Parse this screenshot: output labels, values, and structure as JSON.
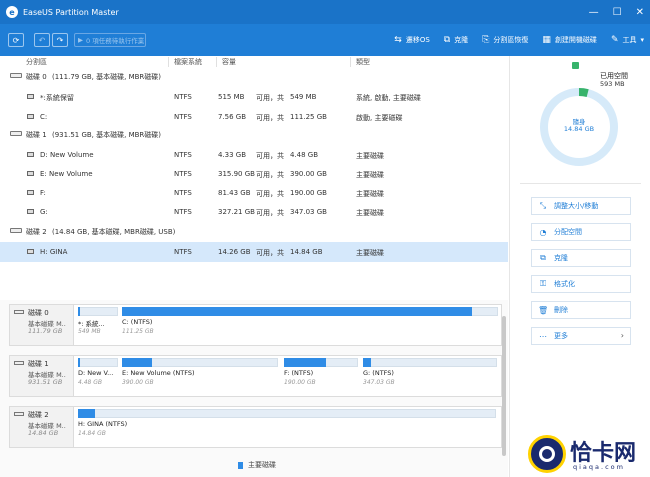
{
  "window": {
    "title": "EaseUS Partition Master",
    "minimize": "—",
    "maximize": "☐",
    "close": "✕"
  },
  "toolbar": {
    "refresh_icon": "refresh-icon",
    "pending_label": "0 項任務待執行作業",
    "tools": [
      {
        "label": "遷移OS",
        "icon": "⇆"
      },
      {
        "label": "克隆",
        "icon": "⧉"
      },
      {
        "label": "分割區恢復",
        "icon": "⎘"
      },
      {
        "label": "創建開機磁碟",
        "icon": "▦"
      },
      {
        "label": "工具",
        "icon": "✎"
      }
    ],
    "tools_more": "▾"
  },
  "columns": {
    "partition": "分割區",
    "filesystem": "檔案系統",
    "capacity": "容量",
    "type": "類型"
  },
  "disks": [
    {
      "name": "磁碟 0",
      "desc": "(111.79 GB, 基本磁碟, MBR磁碟)",
      "partitions": [
        {
          "name": "*:系統保留",
          "fs": "NTFS",
          "used": "515 MB",
          "sep": "可用，共",
          "total": "549 MB",
          "type": "系統, 啟動, 主要磁碟"
        },
        {
          "name": "C:",
          "fs": "NTFS",
          "used": "7.56 GB",
          "sep": "可用，共",
          "total": "111.25 GB",
          "type": "啟動, 主要磁碟"
        }
      ]
    },
    {
      "name": "磁碟 1",
      "desc": "(931.51 GB, 基本磁碟, MBR磁碟)",
      "partitions": [
        {
          "name": "D: New Volume",
          "fs": "NTFS",
          "used": "4.33 GB",
          "sep": "可用，共",
          "total": "4.48 GB",
          "type": "主要磁碟"
        },
        {
          "name": "E: New Volume",
          "fs": "NTFS",
          "used": "315.90 GB",
          "sep": "可用，共",
          "total": "390.00 GB",
          "type": "主要磁碟"
        },
        {
          "name": "F:",
          "fs": "NTFS",
          "used": "81.43 GB",
          "sep": "可用，共",
          "total": "190.00 GB",
          "type": "主要磁碟"
        },
        {
          "name": "G:",
          "fs": "NTFS",
          "used": "327.21 GB",
          "sep": "可用，共",
          "total": "347.03 GB",
          "type": "主要磁碟"
        }
      ]
    },
    {
      "name": "磁碟 2",
      "desc": "(14.84 GB, 基本磁碟, MBR磁碟, USB)",
      "partitions": [
        {
          "name": "H: GINA",
          "fs": "NTFS",
          "used": "14.26 GB",
          "sep": "可用，共",
          "total": "14.84 GB",
          "type": "主要磁碟"
        }
      ]
    }
  ],
  "disk_map": [
    {
      "name": "磁碟 0",
      "type": "基本磁碟 M..",
      "size": "111.79 GB",
      "segments": [
        {
          "label": "*: 系統...",
          "size": "549 MB",
          "fill": 0.06
        },
        {
          "label": "C: (NTFS)",
          "size": "111.25 GB",
          "fill": 0.93
        }
      ]
    },
    {
      "name": "磁碟 1",
      "type": "基本磁碟 M..",
      "size": "931.51 GB",
      "segments": [
        {
          "label": "D: New V...",
          "size": "4.48 GB",
          "fill": 0.03
        },
        {
          "label": "E: New Volume (NTFS)",
          "size": "390.00 GB",
          "fill": 0.19
        },
        {
          "label": "F: (NTFS)",
          "size": "190.00 GB",
          "fill": 0.57
        },
        {
          "label": "G: (NTFS)",
          "size": "347.03 GB",
          "fill": 0.06
        }
      ]
    },
    {
      "name": "磁碟 2",
      "type": "基本磁碟 M..",
      "size": "14.84 GB",
      "segments": [
        {
          "label": "H: GINA (NTFS)",
          "size": "14.84 GB",
          "fill": 0.04
        }
      ]
    }
  ],
  "legend": {
    "label": "主要磁碟",
    "color": "#2f8ce6"
  },
  "usage": {
    "used_label": "已用空間",
    "used_value": "593 MB",
    "free_label": "隨身",
    "free_value": "14.84 GB",
    "used_fraction": 0.04
  },
  "actions": [
    {
      "label": "調整大小/移動",
      "icon": "⤡"
    },
    {
      "label": "分配空間",
      "icon": "◔"
    },
    {
      "label": "克隆",
      "icon": "⧉"
    },
    {
      "label": "格式化",
      "icon": "⚿"
    },
    {
      "label": "刪除",
      "icon": "🗑"
    },
    {
      "label": "更多",
      "icon": "⋯",
      "chevron": "›"
    }
  ],
  "watermark": {
    "text": "恰卡网",
    "sub": "qiaqa.com"
  },
  "colors": {
    "toolbar": "#1f7ed6",
    "titlebar": "#1a73c8",
    "accent": "#2f8ce6",
    "selected_row": "#d5e8fb"
  }
}
